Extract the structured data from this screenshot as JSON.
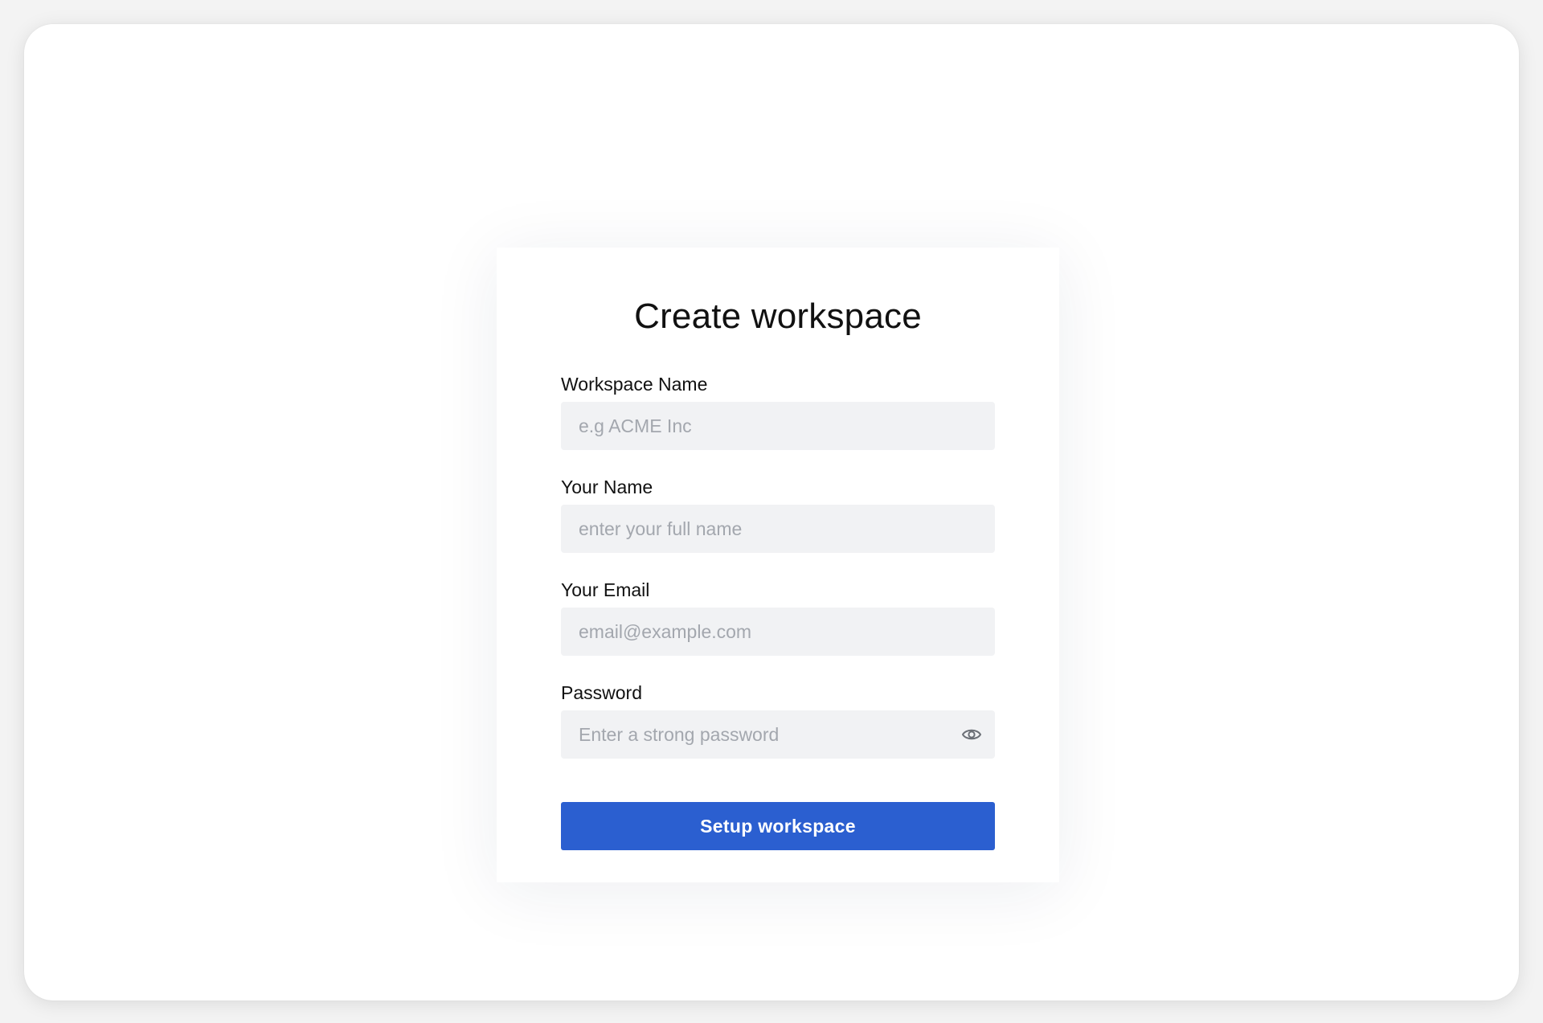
{
  "form": {
    "title": "Create workspace",
    "fields": [
      {
        "label": "Workspace Name",
        "placeholder": "e.g ACME Inc",
        "value": ""
      },
      {
        "label": "Your Name",
        "placeholder": "enter your full name",
        "value": ""
      },
      {
        "label": "Your Email",
        "placeholder": "email@example.com",
        "value": ""
      },
      {
        "label": "Password",
        "placeholder": "Enter a strong password",
        "value": "",
        "icon": "eye-icon"
      }
    ],
    "submit_label": "Setup workspace"
  },
  "colors": {
    "accent": "#2b5fd0",
    "input_bg": "#f1f2f4",
    "placeholder": "#a3a7ae"
  }
}
